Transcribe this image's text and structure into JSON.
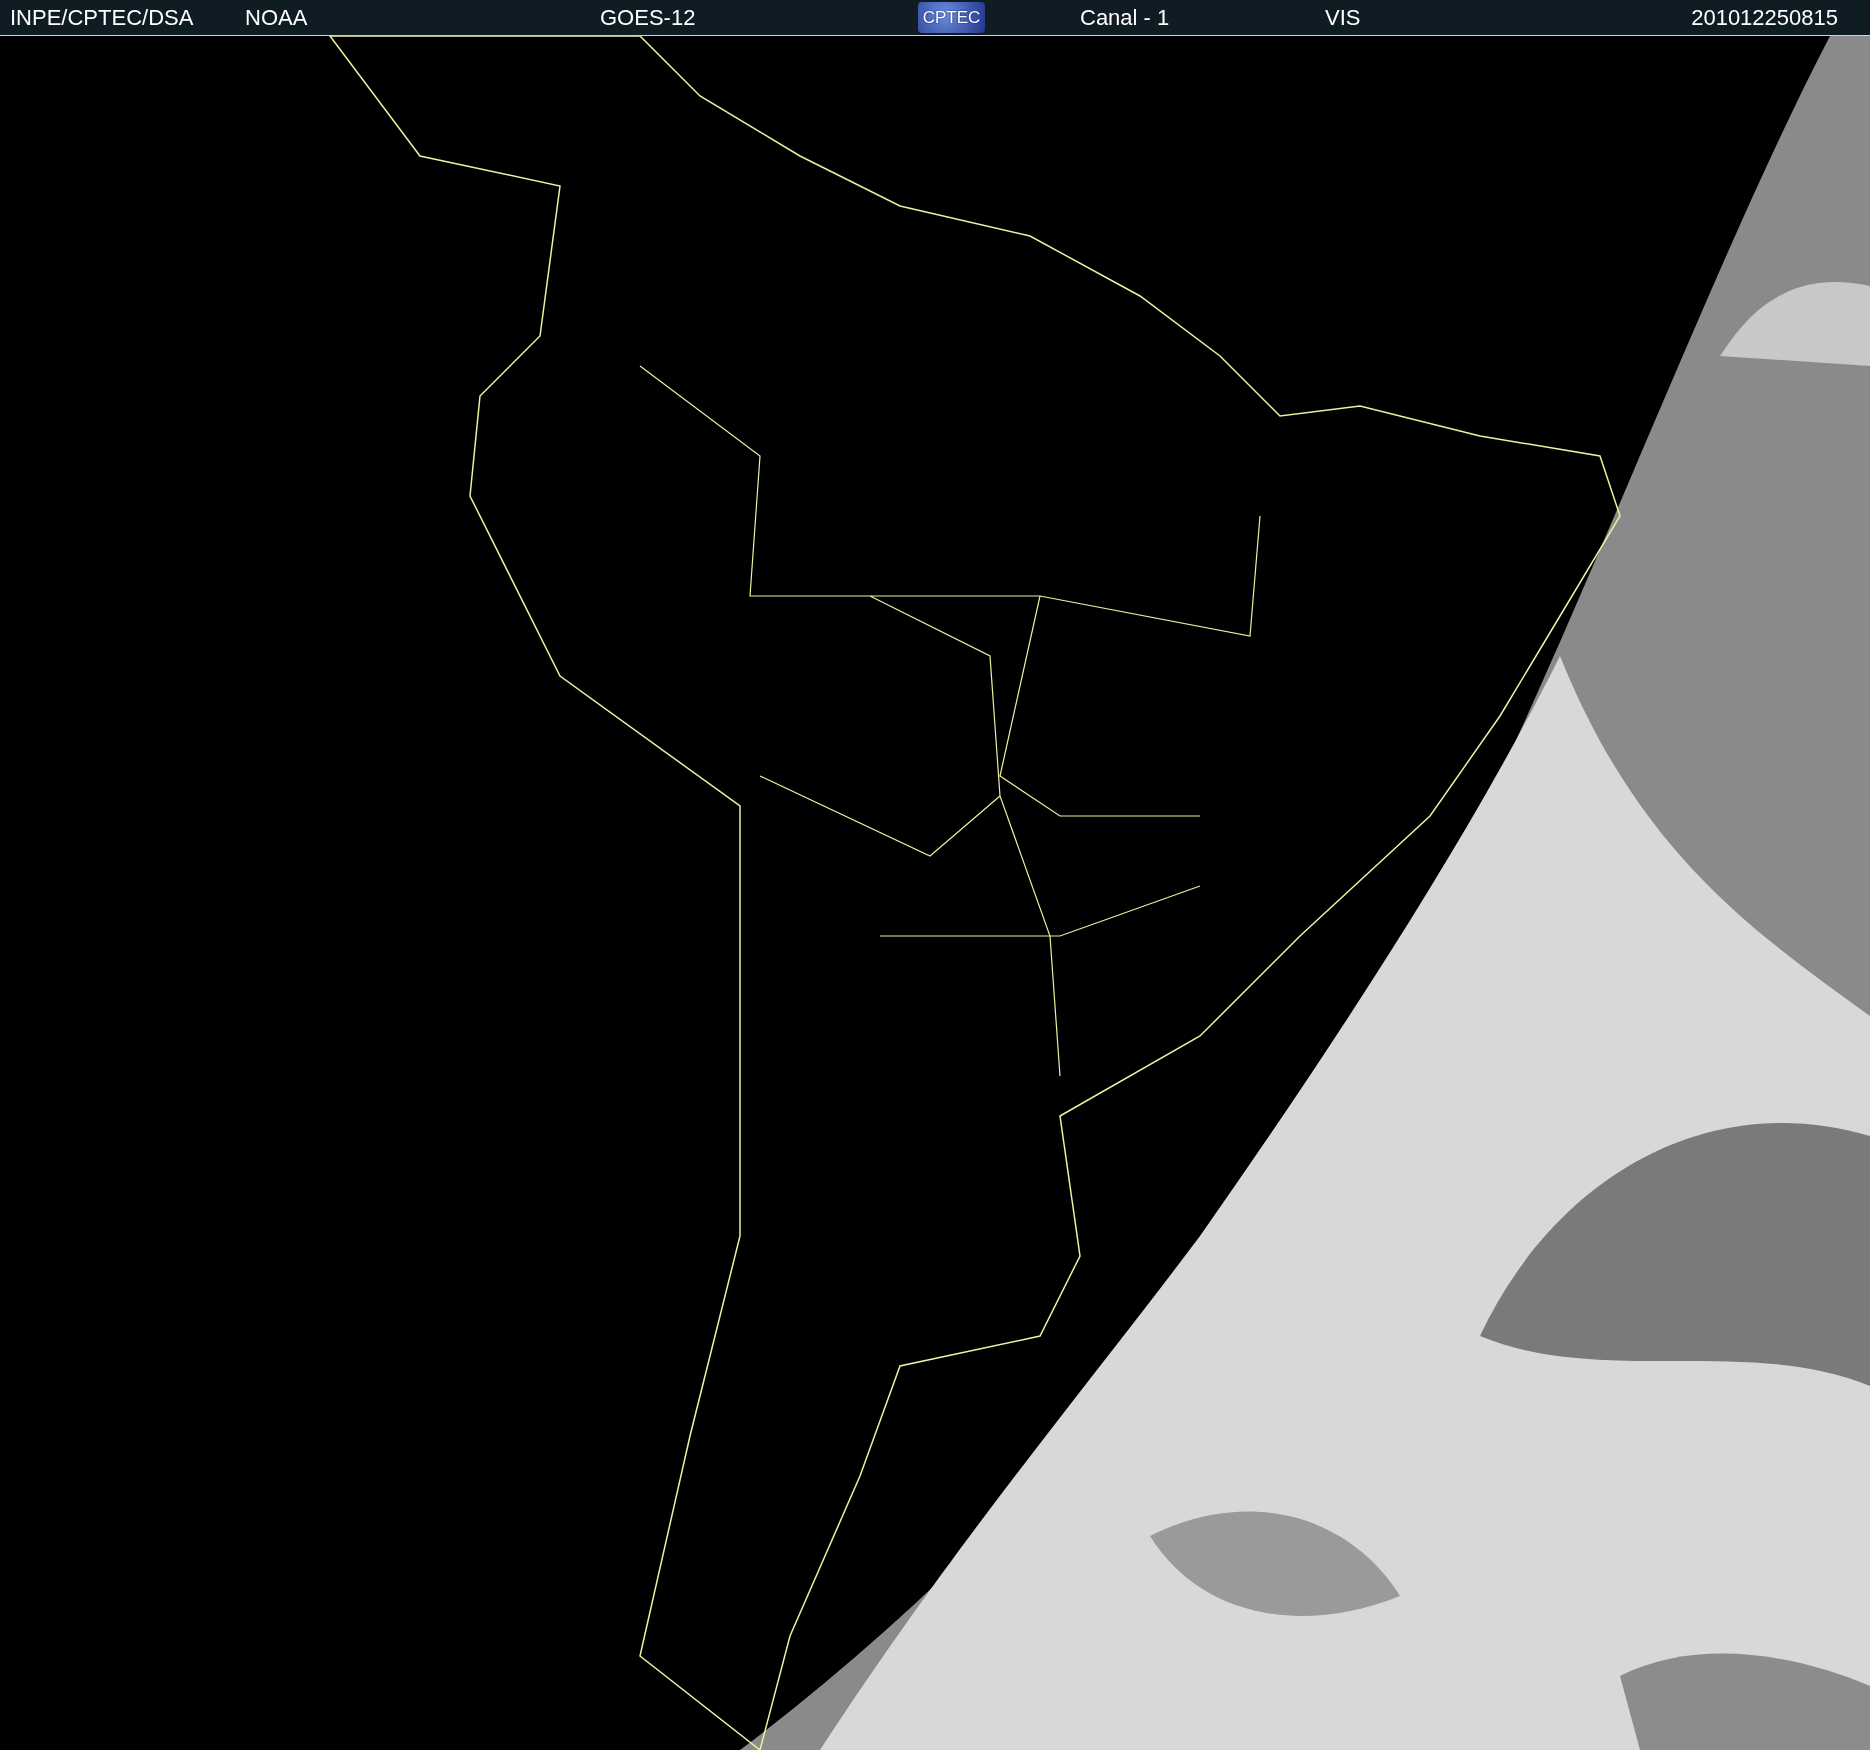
{
  "header": [
    {
      "kind": "text",
      "text": "INPE/CPTEC/DSA"
    },
    {
      "kind": "text",
      "text": "NOAA"
    },
    {
      "kind": "text",
      "text": "GOES-12"
    },
    {
      "kind": "logo",
      "text": "CPTEC"
    },
    {
      "kind": "text",
      "text": "Canal - 1"
    },
    {
      "kind": "text",
      "text": "VIS"
    },
    {
      "kind": "text",
      "text": "201012250815"
    }
  ]
}
